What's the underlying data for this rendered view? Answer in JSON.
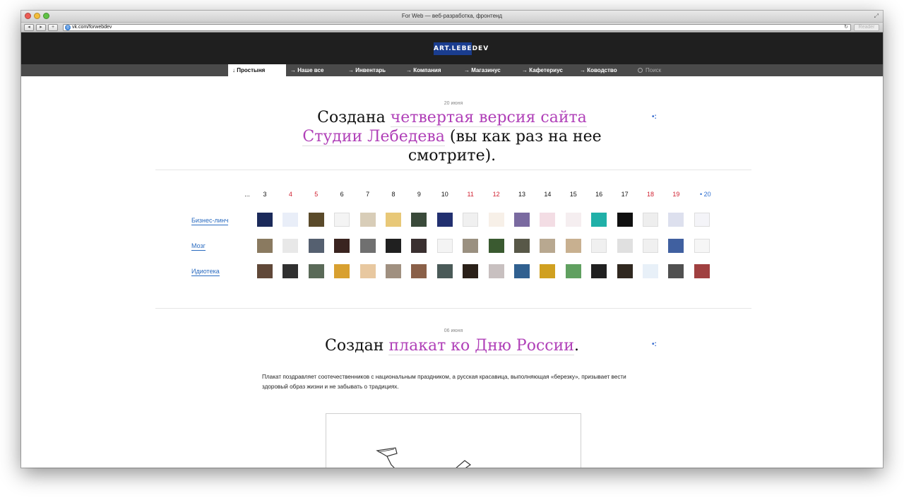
{
  "window": {
    "title": "For Web — веб-разработка, фронтенд"
  },
  "browser": {
    "back": "◂",
    "forward": "▸",
    "add": "+",
    "url": "vk.com/forwebdev",
    "reader": "Reader"
  },
  "site": {
    "logo": "ART.LEBEDEV",
    "menu": [
      {
        "label": "↓ Простыня"
      },
      {
        "label": "→ Наше все"
      },
      {
        "label": "→ Инвентарь"
      },
      {
        "label": "→ Компания"
      },
      {
        "label": "→ Магазинус"
      },
      {
        "label": "→ Кафетериус"
      },
      {
        "label": "→ Ководство"
      }
    ],
    "search_placeholder": "Поиск"
  },
  "post1": {
    "date": "20 июня",
    "pre": "Создана ",
    "link": "четвертая версия сайта Студии Лебедева",
    "post": " (вы как раз на нее смотрите)."
  },
  "calendar": {
    "ellipsis": "...",
    "days": [
      {
        "n": "3",
        "weekend": false
      },
      {
        "n": "4",
        "weekend": true
      },
      {
        "n": "5",
        "weekend": true
      },
      {
        "n": "6",
        "weekend": false
      },
      {
        "n": "7",
        "weekend": false
      },
      {
        "n": "8",
        "weekend": false
      },
      {
        "n": "9",
        "weekend": false
      },
      {
        "n": "10",
        "weekend": false
      },
      {
        "n": "11",
        "weekend": true
      },
      {
        "n": "12",
        "weekend": true
      },
      {
        "n": "13",
        "weekend": false
      },
      {
        "n": "14",
        "weekend": false
      },
      {
        "n": "15",
        "weekend": false
      },
      {
        "n": "16",
        "weekend": false
      },
      {
        "n": "17",
        "weekend": false
      },
      {
        "n": "18",
        "weekend": true
      },
      {
        "n": "19",
        "weekend": true
      },
      {
        "n": "• 20",
        "weekend": false,
        "current": true
      }
    ],
    "rows": [
      {
        "label": "Бизнес-линч",
        "colors": [
          "#1b2a5a",
          "#e9eef8",
          "#5a4a2a",
          "#f4f4f4",
          "#d8cdb8",
          "#e8c878",
          "#3a4a3a",
          "#223070",
          "#f0f0f0",
          "#f7f0e8",
          "#7a6aa0",
          "#f3dde4",
          "#f5eef0",
          "#20b0a8",
          "#101010",
          "#eeeeee",
          "#dde0ee",
          "#f4f4f8"
        ]
      },
      {
        "label": "Мозг",
        "colors": [
          "#8a7a60",
          "#e8e8e8",
          "#556070",
          "#3a2420",
          "#707070",
          "#202020",
          "#3a3030",
          "#f4f4f4",
          "#9a9080",
          "#3a5a30",
          "#585848",
          "#b8a890",
          "#c8b090",
          "#f0f0f0",
          "#e0e0e0",
          "#f0f0f0",
          "#4060a0",
          "#f6f6f6"
        ]
      },
      {
        "label": "Идиотека",
        "colors": [
          "#604838",
          "#303030",
          "#5a6a58",
          "#d8a030",
          "#e8c8a0",
          "#a09080",
          "#8a6048",
          "#4a5a58",
          "#2a2018",
          "#c8c0c0",
          "#306090",
          "#d0a020",
          "#60a060",
          "#202020",
          "#302820",
          "#e8f0f8",
          "#505050",
          "#a04040"
        ]
      }
    ]
  },
  "post2": {
    "date": "06 июня",
    "pre": "Создан ",
    "link": "плакат ко Дню России",
    "post": ".",
    "body": "Плакат поздравляет соотечественников с национальным праздником, а русская красавица, выполняющая «березку», призывает вести здоровый образ жизни и не забывать о традициях."
  },
  "share_glyph": "•:"
}
